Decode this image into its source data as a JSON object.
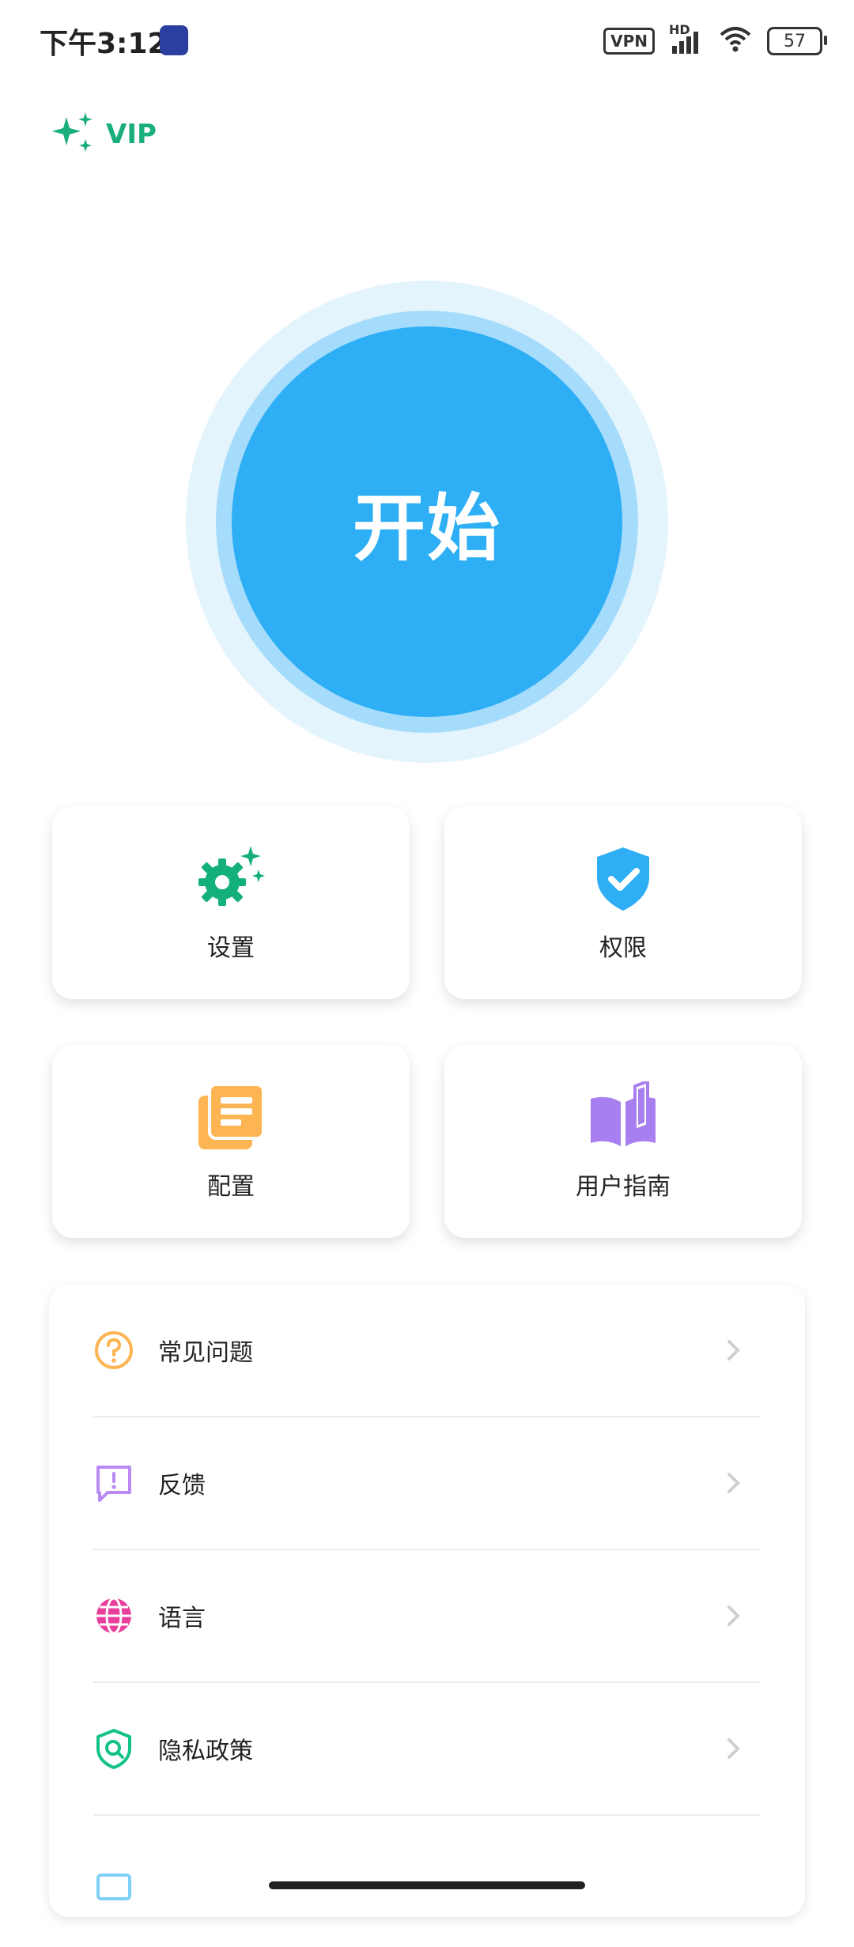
{
  "status": {
    "time": "下午3:12",
    "vpn": "VPN",
    "hd": "HD",
    "battery": "57"
  },
  "vip": {
    "label": "VIP",
    "color": "#1aae7b"
  },
  "start_button": {
    "label": "开始",
    "color": "#2daef5"
  },
  "tiles": [
    {
      "label": "设置",
      "icon": "gear-sparkle-icon",
      "color": "#14b07a"
    },
    {
      "label": "权限",
      "icon": "shield-check-icon",
      "color": "#2daef5"
    },
    {
      "label": "配置",
      "icon": "document-stack-icon",
      "color": "#fcb552"
    },
    {
      "label": "用户指南",
      "icon": "book-open-icon",
      "color": "#a77ff0"
    }
  ],
  "menu": [
    {
      "label": "常见问题",
      "icon": "question-circle-icon",
      "color": "#fcb552"
    },
    {
      "label": "反馈",
      "icon": "feedback-icon",
      "color": "#b98af4"
    },
    {
      "label": "语言",
      "icon": "globe-icon",
      "color": "#e83e9c"
    },
    {
      "label": "隐私政策",
      "icon": "privacy-shield-icon",
      "color": "#14c18a"
    }
  ]
}
